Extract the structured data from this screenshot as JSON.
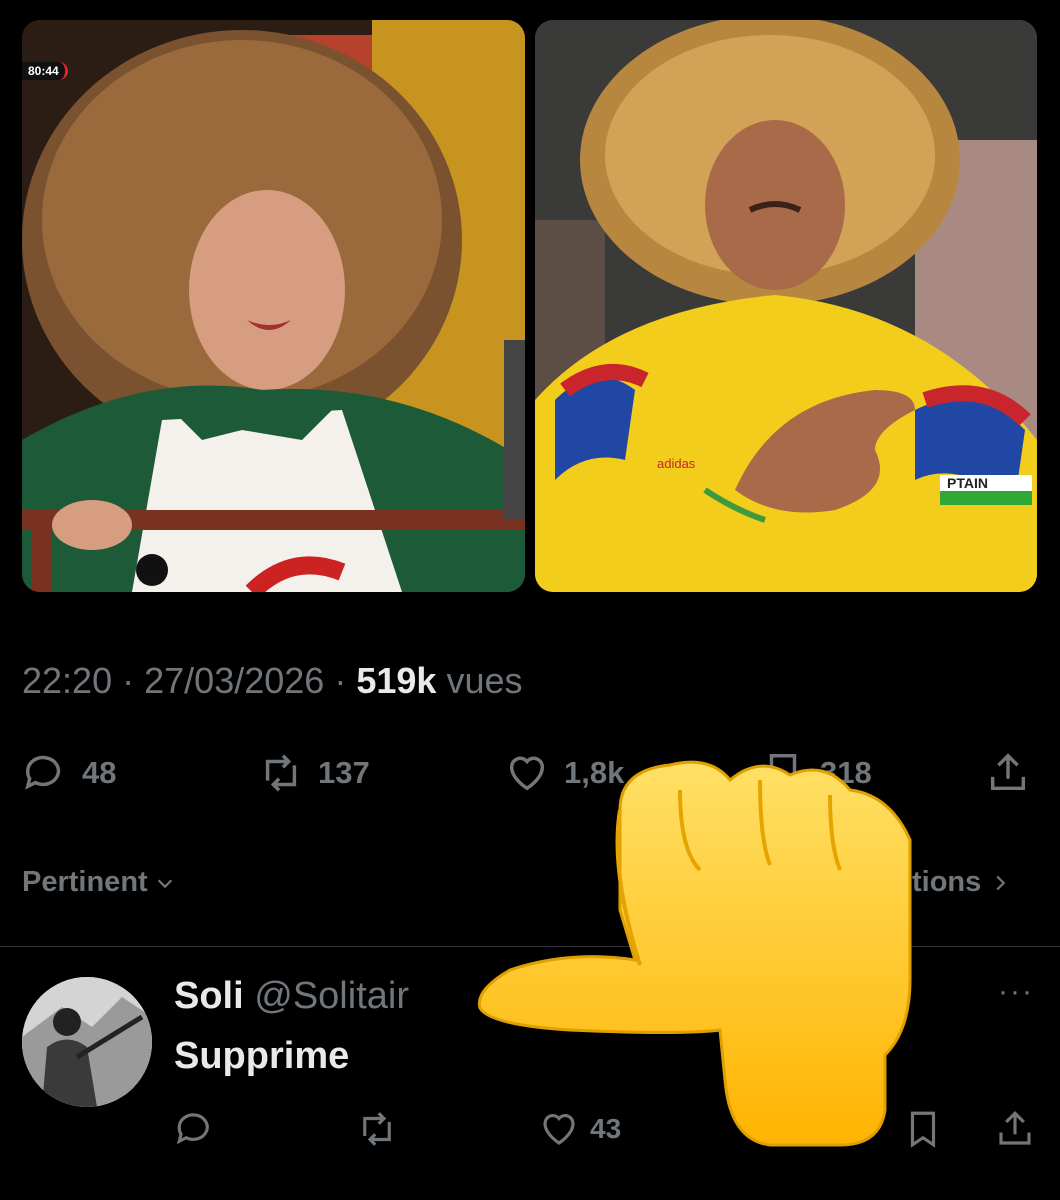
{
  "tweet": {
    "time": "22:20",
    "date": "27/03/2026",
    "sep": "·",
    "views_count": "519k",
    "views_label": "vues",
    "overlay_timer": "80:44"
  },
  "actions": {
    "replies": "48",
    "reposts": "137",
    "likes": "1,8k",
    "bookmarks": "318"
  },
  "sort": {
    "label": "Pertinent",
    "right_label": "tions"
  },
  "reply": {
    "name": "Soli",
    "handle": "@Solitair",
    "text": "Supprime",
    "likes": "43",
    "more": "···"
  },
  "photos": {
    "right_armband": "PTAIN",
    "right_logo": "adidas"
  },
  "colors": {
    "background": "#000000",
    "muted": "#71767b",
    "text": "#e7e9ea",
    "jersey_yellow": "#f3cd1c",
    "emoji_yellow": "#ffcc33"
  },
  "icons": [
    "reply-icon",
    "repost-icon",
    "like-icon",
    "bookmark-icon",
    "share-icon",
    "chevron-down-icon",
    "chevron-right-icon",
    "more-icon",
    "thumbs-down-emoji"
  ]
}
